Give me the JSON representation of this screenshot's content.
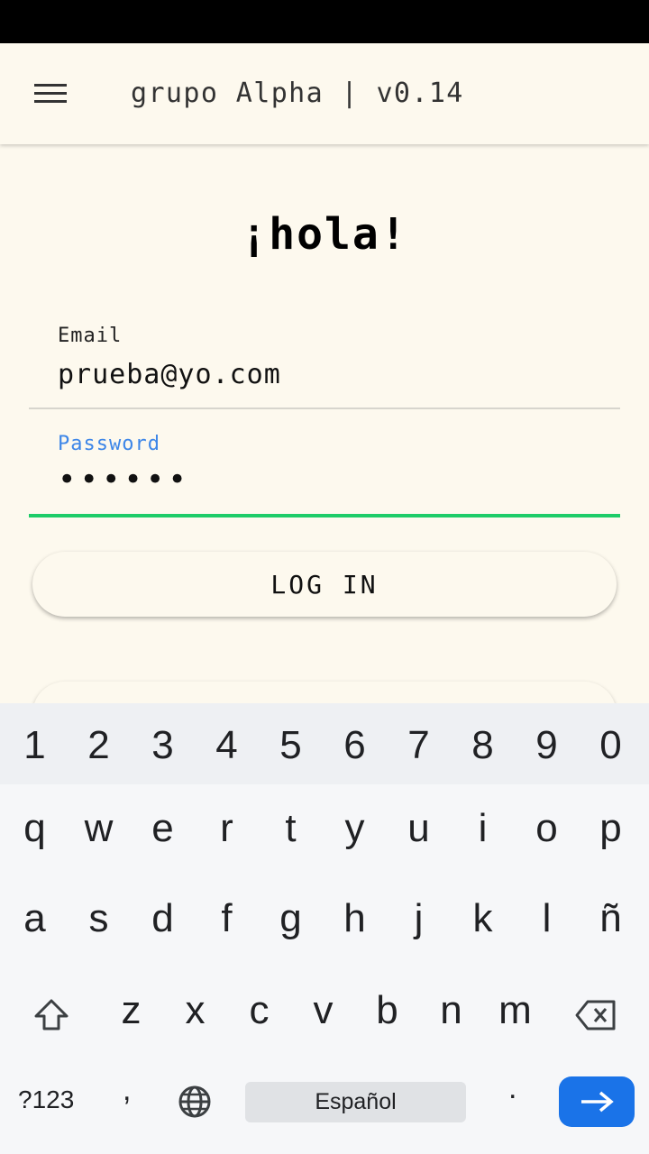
{
  "app_bar": {
    "title": "grupo Alpha | v0.14",
    "menu_icon": "hamburger-menu-icon"
  },
  "greeting": "¡hola!",
  "form": {
    "email_label": "Email",
    "email_value": "prueba@yo.com",
    "password_label": "Password",
    "password_masked": "••••••",
    "login_label": "LOG IN"
  },
  "keyboard": {
    "numbers": [
      "1",
      "2",
      "3",
      "4",
      "5",
      "6",
      "7",
      "8",
      "9",
      "0"
    ],
    "row1": [
      "q",
      "w",
      "e",
      "r",
      "t",
      "y",
      "u",
      "i",
      "o",
      "p"
    ],
    "row2": [
      "a",
      "s",
      "d",
      "f",
      "g",
      "h",
      "j",
      "k",
      "l",
      "ñ"
    ],
    "row3": [
      "z",
      "x",
      "c",
      "v",
      "b",
      "n",
      "m"
    ],
    "symbols_label": "?123",
    "comma": ",",
    "space_label": "Español",
    "period": ".",
    "enter_icon": "arrow-right-icon",
    "shift_icon": "shift-icon",
    "backspace_icon": "backspace-icon",
    "globe_icon": "globe-icon"
  },
  "colors": {
    "background": "#fdf9ee",
    "focus_underline": "#1ecc68",
    "focus_label": "#3d86e8",
    "enter_key": "#1a73e8"
  }
}
